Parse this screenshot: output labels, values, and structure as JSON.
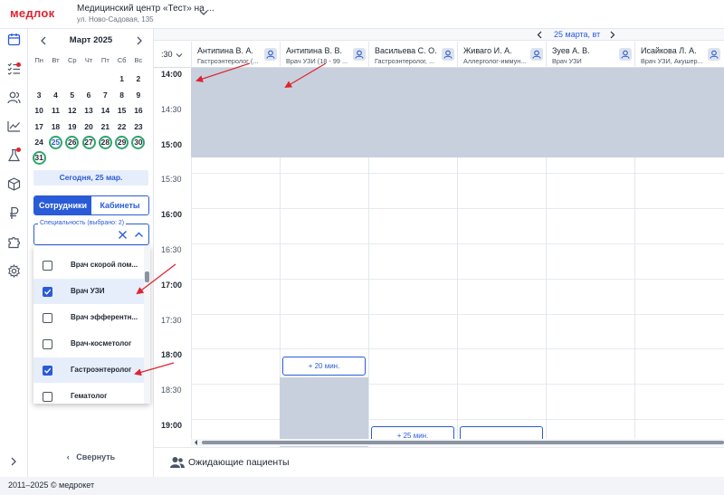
{
  "header": {
    "logo": "медлок",
    "clinic_name": "Медицинский центр «Тест» на ...",
    "clinic_address": "ул. Ново-Садовая, 135"
  },
  "rail": {
    "icons": [
      "calendar-icon",
      "checklist-icon",
      "users-icon",
      "chart-icon",
      "flask-icon",
      "box-icon",
      "ruble-icon",
      "puzzle-icon",
      "gear-icon"
    ]
  },
  "calendar": {
    "month_label": "Март 2025",
    "weekdays": [
      "Пн",
      "Вт",
      "Ср",
      "Чт",
      "Пт",
      "Сб",
      "Вс"
    ],
    "weeks": [
      [
        "",
        "",
        "",
        "",
        "",
        "1",
        "2"
      ],
      [
        "3",
        "4",
        "5",
        "6",
        "7",
        "8",
        "9"
      ],
      [
        "10",
        "11",
        "12",
        "13",
        "14",
        "15",
        "16"
      ],
      [
        "17",
        "18",
        "19",
        "20",
        "21",
        "22",
        "23"
      ],
      [
        "24",
        "25",
        "26",
        "27",
        "28",
        "29",
        "30"
      ],
      [
        "31",
        "",
        "",
        "",
        "",
        "",
        ""
      ]
    ],
    "ringed_days": [
      "25",
      "26",
      "27",
      "28",
      "29",
      "30",
      "31"
    ],
    "today_day": "25",
    "today_button": "Сегодня, 25 мар."
  },
  "segment": {
    "staff": "Сотрудники",
    "rooms": "Кабинеты",
    "active": "staff"
  },
  "specialty": {
    "label": "Специальность (выбрано: 2)",
    "options": [
      {
        "label": "Врач скорой пом...",
        "checked": false
      },
      {
        "label": "Врач УЗИ",
        "checked": true
      },
      {
        "label": "Врач эфферентн...",
        "checked": false
      },
      {
        "label": "Врач-косметолог",
        "checked": false
      },
      {
        "label": "Гастроэнтеролог",
        "checked": true
      },
      {
        "label": "Гематолог",
        "checked": false
      }
    ]
  },
  "collapse_label": "Свернуть",
  "schedule": {
    "date_label": "25 марта, вт",
    "time_selector": ":30",
    "doctors": [
      {
        "name": "Антипина В. А.",
        "spec": "Гастроэнтеролог (..."
      },
      {
        "name": "Антипина В. В.",
        "spec": "Врач УЗИ (18 - 99 ..."
      },
      {
        "name": "Васильева С. О.",
        "spec": "Гастроэнтеролог, ..."
      },
      {
        "name": "Живаго И. А.",
        "spec": "Аллерголог-иммун..."
      },
      {
        "name": "Зуев А. В.",
        "spec": "Врач УЗИ"
      },
      {
        "name": "Исайкова Л. А.",
        "spec": "Врач УЗИ, Акушер..."
      }
    ],
    "times": [
      "14:00",
      "14:30",
      "15:00",
      "15:30",
      "16:00",
      "16:30",
      "17:00",
      "17:30",
      "18:00",
      "18:30",
      "19:00"
    ],
    "slots": [
      {
        "label": "+ 20 мин."
      },
      {
        "label": "+ 25 мин."
      },
      {
        "label": ""
      }
    ]
  },
  "waiting_label": "Ожидающие пациенты",
  "footer": "2011–2025 © медрокет",
  "colors": {
    "accent": "#2a5bd7",
    "brand": "#e0232f",
    "busy": "#c8d0dd",
    "ring": "#2fa56b",
    "annotation_arrow": "#e0232f"
  }
}
